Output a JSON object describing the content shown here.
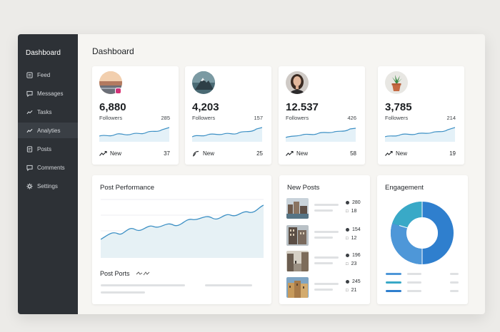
{
  "sidebar": {
    "title": "Dashboard",
    "items": [
      {
        "label": "Feed",
        "icon": "feed-icon"
      },
      {
        "label": "Messages",
        "icon": "message-icon"
      },
      {
        "label": "Tasks",
        "icon": "trend-icon"
      },
      {
        "label": "Analyties",
        "icon": "trend-icon",
        "active": true
      },
      {
        "label": "Posts",
        "icon": "posts-icon"
      },
      {
        "label": "Comments",
        "icon": "comment-icon"
      },
      {
        "label": "Settings",
        "icon": "gear-icon"
      }
    ]
  },
  "main": {
    "title": "Dashboard"
  },
  "stats": [
    {
      "value": "6,880",
      "label": "Followers",
      "count": "285",
      "new_label": "New",
      "new_count": "37",
      "avatar": "sunset-landscape"
    },
    {
      "value": "4,203",
      "label": "Followers",
      "count": "157",
      "new_label": "New",
      "new_count": "25",
      "avatar": "mountain"
    },
    {
      "value": "12.537",
      "label": "Followers",
      "count": "426",
      "new_label": "New",
      "new_count": "58",
      "avatar": "woman-portrait"
    },
    {
      "value": "3,785",
      "label": "Followers",
      "count": "214",
      "new_label": "New",
      "new_count": "19",
      "avatar": "potted-plant"
    }
  ],
  "post_performance": {
    "title": "Post Performance",
    "sub_title": "Post Ports"
  },
  "new_posts": {
    "title": "New Posts",
    "items": [
      {
        "likes": "280",
        "comments": "18",
        "thumb": "city-waterfront"
      },
      {
        "likes": "154",
        "comments": "12",
        "thumb": "building-street"
      },
      {
        "likes": "196",
        "comments": "23",
        "thumb": "city-street"
      },
      {
        "likes": "245",
        "comments": "21",
        "thumb": "european-buildings"
      }
    ]
  },
  "engagement": {
    "title": "Engagement"
  },
  "colors": {
    "sidebar_bg": "#2d3136",
    "accent_line": "#3b8fc4",
    "accent_fill": "#e4f1f8",
    "donut_dark": "#2f7fce",
    "donut_mid": "#4e97d8",
    "donut_light": "#39a9c7"
  }
}
